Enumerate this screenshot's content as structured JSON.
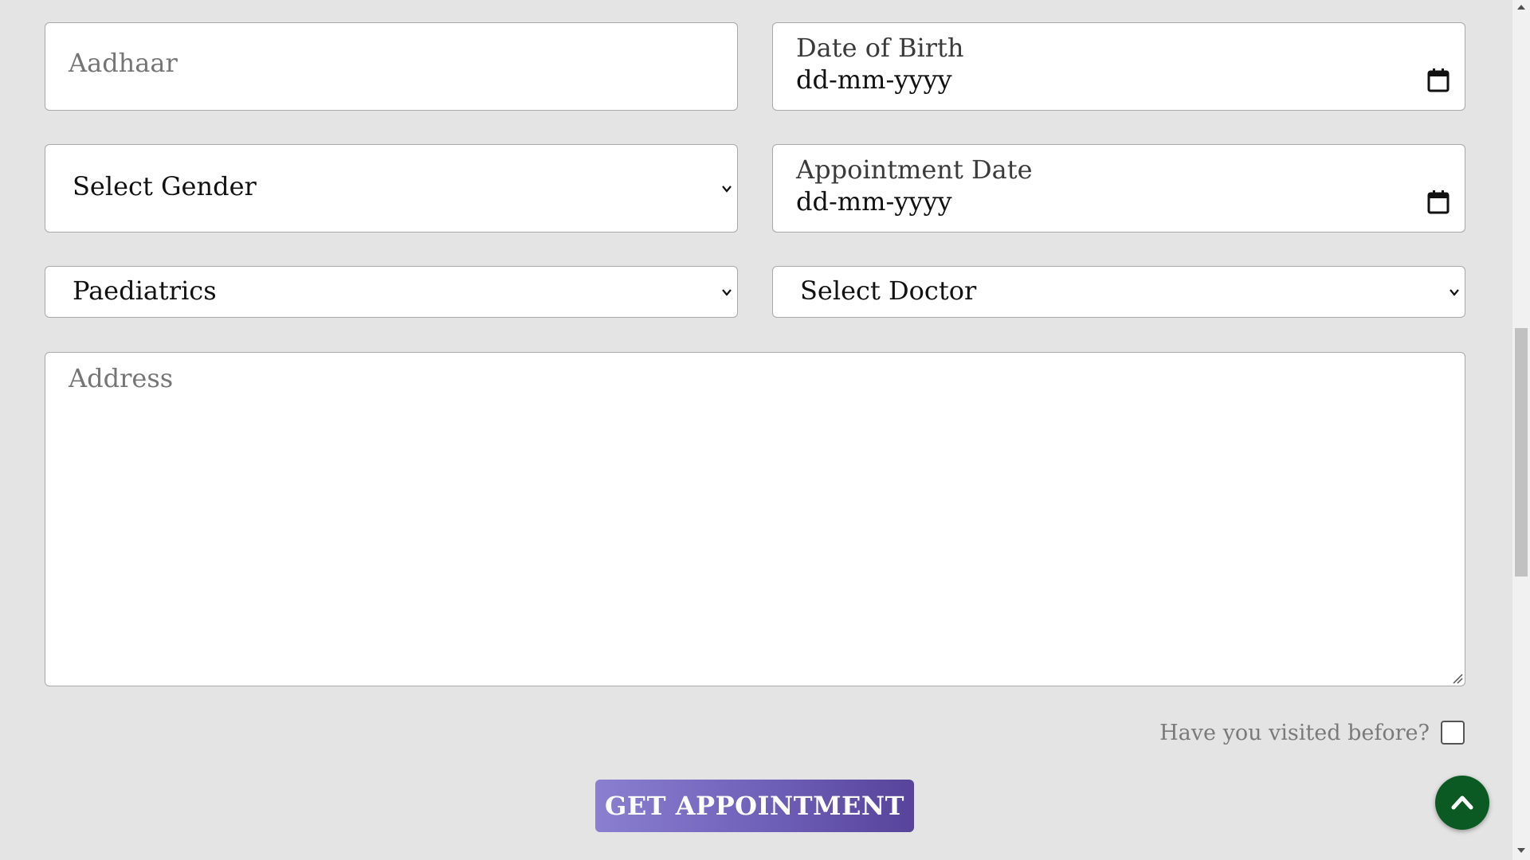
{
  "form": {
    "aadhaar_placeholder": "Aadhaar",
    "dob": {
      "label": "Date of Birth",
      "value": "dd-mm-yyyy"
    },
    "gender": {
      "selected": "Select Gender"
    },
    "appointment_date": {
      "label": "Appointment Date",
      "value": "dd-mm-yyyy"
    },
    "department": {
      "selected": "Paediatrics"
    },
    "doctor": {
      "selected": "Select Doctor"
    },
    "address_placeholder": "Address",
    "visited_label": "Have you visited before?",
    "visited_checked": false,
    "submit_label": "GET APPOINTMENT"
  },
  "icons": {
    "calendar": "calendar-icon",
    "chevron": "chevron-down-icon",
    "back_to_top": "chevron-up-icon"
  },
  "colors": {
    "background": "#e4e4e4",
    "button_gradient_start": "#8a7fd0",
    "button_gradient_end": "#57449a",
    "fab": "#0b5a23"
  }
}
